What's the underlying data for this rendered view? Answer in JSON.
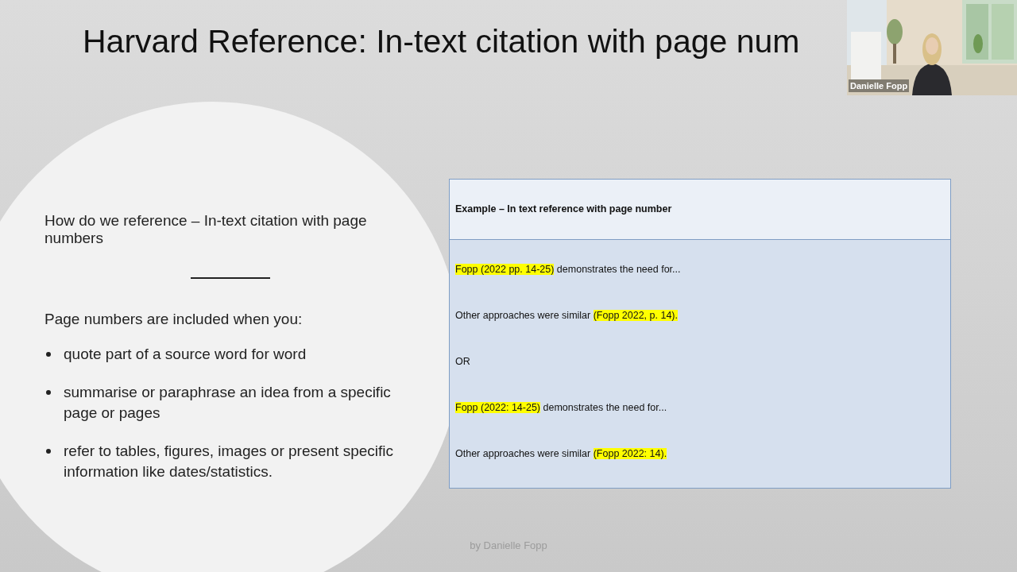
{
  "slide": {
    "title": "Harvard Reference: In-text citation with page num",
    "intro": "How do we reference – In-text citation with page numbers",
    "lead": "Page numbers are included when you:",
    "bullets": [
      "quote part of a source word for word",
      "summarise or paraphrase an idea from a specific page or pages",
      "refer to tables, figures, images or present specific information like dates/statistics."
    ],
    "table": {
      "header": "Example – In text reference with page number",
      "rows": [
        {
          "segments": [
            {
              "text": "Fopp (2022 pp. 14-25)",
              "highlighted": true
            },
            {
              "text": " demonstrates the need for...",
              "highlighted": false
            }
          ]
        },
        {
          "segments": [
            {
              "text": "Other approaches were similar ",
              "highlighted": false
            },
            {
              "text": "(Fopp 2022, p. 14).",
              "highlighted": true
            }
          ]
        },
        {
          "segments": [
            {
              "text": "OR",
              "highlighted": false
            }
          ]
        },
        {
          "segments": [
            {
              "text": "Fopp (2022: 14-25)",
              "highlighted": true
            },
            {
              "text": " demonstrates the need for...",
              "highlighted": false
            }
          ]
        },
        {
          "segments": [
            {
              "text": "Other approaches were similar ",
              "highlighted": false
            },
            {
              "text": "(Fopp 2022: 14).",
              "highlighted": true
            }
          ]
        }
      ]
    },
    "footer": "by Danielle Fopp"
  },
  "participant": {
    "name": "Danielle Fopp"
  }
}
